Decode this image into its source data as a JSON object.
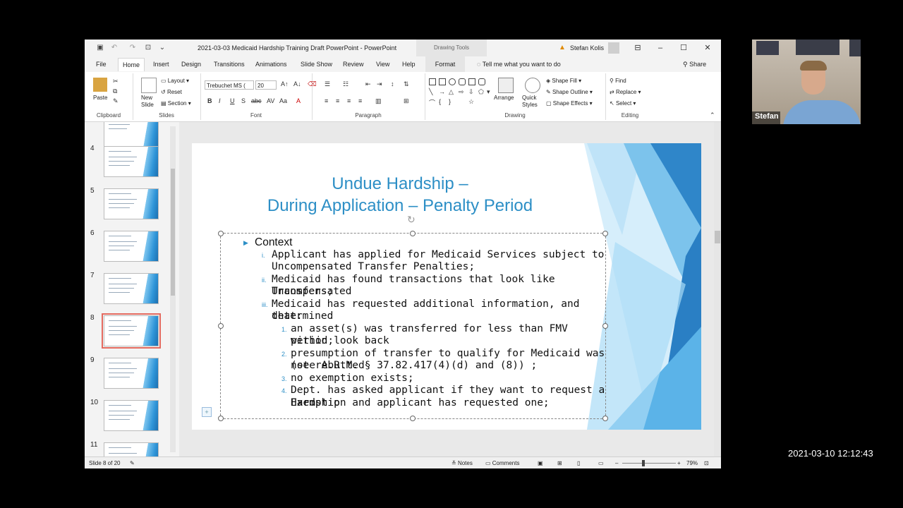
{
  "window": {
    "doc_title": "2021-03-03 Medicaid Hardship Training Draft PowerPoint  -  PowerPoint",
    "drawing_tools": "Drawing Tools",
    "user_name": "Stefan Kolis"
  },
  "tabs": [
    "File",
    "Home",
    "Insert",
    "Design",
    "Transitions",
    "Animations",
    "Slide Show",
    "Review",
    "View",
    "Help",
    "Format"
  ],
  "tell_me": "Tell me what you want to do",
  "share": "Share",
  "ribbon": {
    "clipboard": {
      "paste": "Paste",
      "label": "Clipboard"
    },
    "slides": {
      "new_slide": "New\nSlide",
      "layout": "Layout",
      "reset": "Reset",
      "section": "Section",
      "label": "Slides"
    },
    "font": {
      "name": "Trebuchet MS (",
      "size": "20",
      "label": "Font"
    },
    "paragraph": {
      "label": "Paragraph"
    },
    "drawing": {
      "arrange": "Arrange",
      "quick_styles": "Quick\nStyles",
      "shape_fill": "Shape Fill",
      "shape_outline": "Shape Outline",
      "shape_effects": "Shape Effects",
      "label": "Drawing"
    },
    "editing": {
      "find": "Find",
      "replace": "Replace",
      "select": "Select",
      "label": "Editing"
    }
  },
  "thumbnails": [
    {
      "num": "4",
      "selected": false
    },
    {
      "num": "5",
      "selected": false
    },
    {
      "num": "6",
      "selected": false
    },
    {
      "num": "7",
      "selected": false
    },
    {
      "num": "8",
      "selected": true
    },
    {
      "num": "9",
      "selected": false
    },
    {
      "num": "10",
      "selected": false
    },
    {
      "num": "11",
      "selected": false
    }
  ],
  "slide": {
    "title_line1": "Undue Hardship –",
    "title_line2": "During Application – Penalty Period",
    "bullets": [
      {
        "marker": "▶",
        "level": 0,
        "lines": [
          "Context"
        ]
      },
      {
        "marker": "i.",
        "level": 1,
        "lines": [
          "Applicant has applied for Medicaid Services subject to",
          "Uncompensated Transfer Penalties;"
        ]
      },
      {
        "marker": "ii.",
        "level": 1,
        "lines": [
          "Medicaid has found transactions that look like Uncompensated",
          "Transfers;"
        ]
      },
      {
        "marker": "iii.",
        "level": 1,
        "lines": [
          "Medicaid has requested additional information, and determined",
          "that:"
        ]
      },
      {
        "marker": "1.",
        "level": 2,
        "lines": [
          "an asset(s) was transferred for less than FMV within look back",
          "period;"
        ]
      },
      {
        "marker": "2.",
        "level": 2,
        "lines": [
          "presumption of transfer to qualify for Medicaid was not rebutted",
          "(see A.R.M. § 37.82.417(4)(d) and (8)) ;"
        ]
      },
      {
        "marker": "3.",
        "level": 2,
        "lines": [
          "no exemption exists;"
        ]
      },
      {
        "marker": "4.",
        "level": 2,
        "lines": [
          "Dept. has asked applicant if they want to request a Hardship",
          "Exemption and applicant has requested one;"
        ]
      }
    ]
  },
  "status": {
    "slide_of": "Slide 8 of 20",
    "notes": "Notes",
    "comments": "Comments",
    "zoom": "79%"
  },
  "camera": {
    "name": "Stefan"
  },
  "timestamp": "2021-03-10  12:12:43"
}
